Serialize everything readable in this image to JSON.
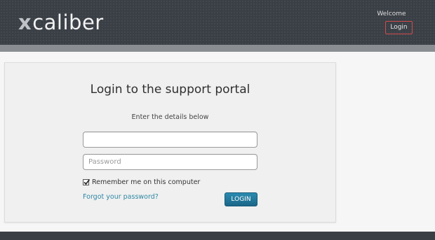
{
  "header": {
    "logo_x": "x",
    "logo_rest": "caliber",
    "welcome": "Welcome",
    "login_link": "Login"
  },
  "panel": {
    "title": "Login to the support portal",
    "subtitle": "Enter the details below",
    "username": {
      "value": "",
      "placeholder": ""
    },
    "password": {
      "value": "",
      "placeholder": "Password"
    },
    "remember_label": "Remember me on this computer",
    "remember_checked": true,
    "forgot_link": "Forgot your password?",
    "login_button": "LOGIN"
  },
  "colors": {
    "header_bg": "#3a3f46",
    "accent_link": "#2e87a4",
    "button_bg": "#1f7296",
    "login_border": "#d14b4b"
  }
}
